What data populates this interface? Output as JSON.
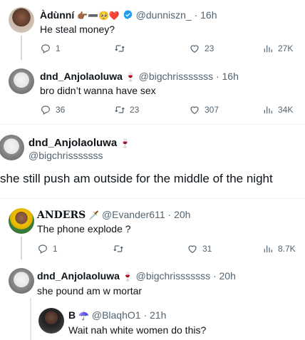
{
  "tweets": [
    {
      "name": "Àdùnní",
      "emojis": "👉🏾➖🥺❤️",
      "verified": true,
      "handle": "@dunniszn_",
      "time": "· 16h",
      "text": "He steal money?",
      "replies": "1",
      "retweets": "",
      "likes": "23",
      "views": "27K"
    },
    {
      "name": "dnd_Anjolaoluwa",
      "emojis": "🍷",
      "handle": "@bigchrisssssss",
      "time": "· 16h",
      "text": "bro didn’t wanna have sex",
      "replies": "36",
      "retweets": "23",
      "likes": "307",
      "views": "34K"
    },
    {
      "name": "dnd_Anjolaoluwa",
      "emojis": "🍷",
      "handle": "@bigchrisssssss",
      "text": "she still push am outside for the middle of the night"
    },
    {
      "name": "𝐀𝐍𝐃𝐄𝐑𝐒",
      "emojis": "🗡️",
      "handle": "@Evander611",
      "time": "· 20h",
      "text": "The phone explode ?",
      "replies": "1",
      "retweets": "",
      "likes": "31",
      "views": "8.7K"
    },
    {
      "name": "dnd_Anjolaoluwa",
      "emojis": "🍷",
      "handle": "@bigchrisssssss",
      "time": "· 20h",
      "text": "she pound am w mortar"
    },
    {
      "name": "B",
      "emojis": "☂️",
      "handle": "@BlaqhO1",
      "time": "· 21h",
      "text": "Wait nah white women do this?"
    }
  ],
  "colors": {
    "verified": "#1d9bf0",
    "muted": "#536471",
    "text": "#0f1419",
    "line": "#cfd9de"
  },
  "icons": [
    "reply-icon",
    "retweet-icon",
    "like-icon",
    "views-icon",
    "verified-icon"
  ]
}
